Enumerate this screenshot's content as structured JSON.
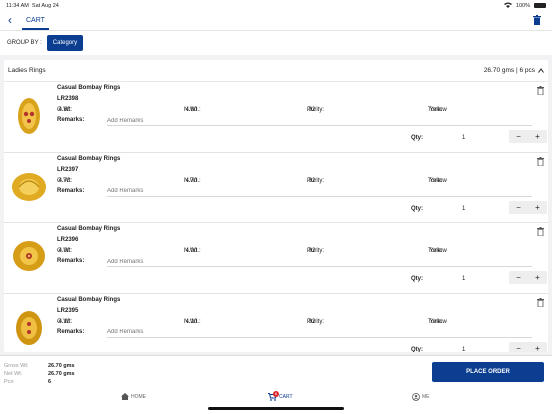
{
  "status": {
    "time": "11:34 AM",
    "date": "Sat Aug 24",
    "battery": "100%"
  },
  "nav": {
    "title": "CART",
    "back_icon": "chevron-left-icon",
    "delete_icon": "trash-icon"
  },
  "group": {
    "label": "GROUP BY :",
    "button": "Category"
  },
  "section": {
    "title": "Ladies Rings",
    "summary": "26.70 gms | 6 pcs"
  },
  "labels": {
    "gwt": "G.Wt:",
    "nwt": "N.Wt.:",
    "purity": "Purity:",
    "tone": "Tone:",
    "remarks": "Remarks:",
    "remarks_placeholder": "Add Remarks",
    "qty": "Qty:",
    "minus": "−",
    "plus": "+"
  },
  "items": [
    {
      "name": "Casual Bombay Rings",
      "code": "LR2398",
      "gwt": "4.80",
      "nwt": "4.80",
      "purity": "92",
      "tone": "Yellow",
      "qty": "1"
    },
    {
      "name": "Casual Bombay Rings",
      "code": "LR2397",
      "gwt": "4.70",
      "nwt": "4.70",
      "purity": "92",
      "tone": "Yellow",
      "qty": "1"
    },
    {
      "name": "Casual Bombay Rings",
      "code": "LR2396",
      "gwt": "4.00",
      "nwt": "4.00",
      "purity": "92",
      "tone": "Yellow",
      "qty": "1"
    },
    {
      "name": "Casual Bombay Rings",
      "code": "LR2395",
      "gwt": "4.10",
      "nwt": "4.10",
      "purity": "92",
      "tone": "Yellow",
      "qty": "1"
    }
  ],
  "totals": {
    "gross_label": "Gross Wt:",
    "gross": "26.70 gms",
    "net_label": "Net Wt:",
    "net": "26.70 gms",
    "pcs_label": "Pcs:",
    "pcs": "6"
  },
  "place_order": "PLACE ORDER",
  "tabs": {
    "home": "HOME",
    "cart": "CART",
    "cart_badge": "6",
    "me": "ME"
  },
  "colors": {
    "accent": "#0b3d91",
    "badge": "#d9262c"
  }
}
